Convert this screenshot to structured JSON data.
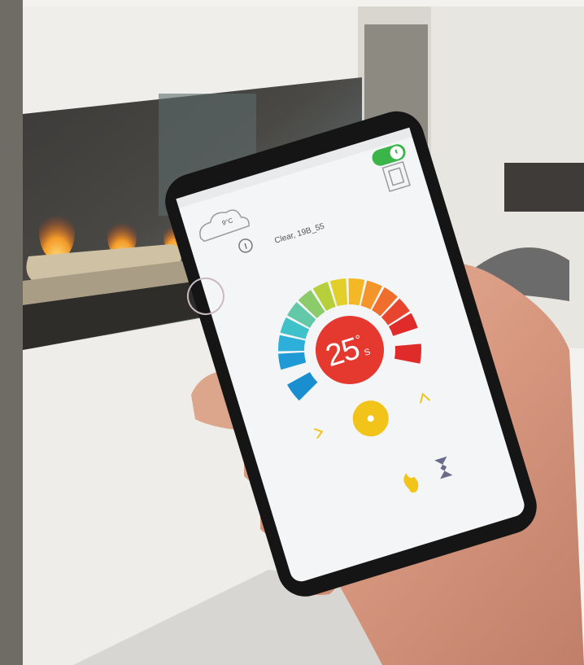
{
  "thermostat": {
    "temperature": "25",
    "degree_symbol": "°",
    "unit": "S",
    "status_text": "Clear, 19B_55",
    "weather_temp": "9°C",
    "power_on": true
  },
  "colors": {
    "accent_red": "#e5392f",
    "power_green": "#3bb54a",
    "flame_yellow": "#f2c318",
    "screen_bg": "#f4f5f7"
  },
  "icons": [
    "cloud-icon",
    "info-icon",
    "power-toggle-icon",
    "speaker-icon",
    "flame-icon",
    "timer-icon",
    "arrow-up-icon",
    "arrow-down-icon",
    "back-arrow-icon"
  ]
}
